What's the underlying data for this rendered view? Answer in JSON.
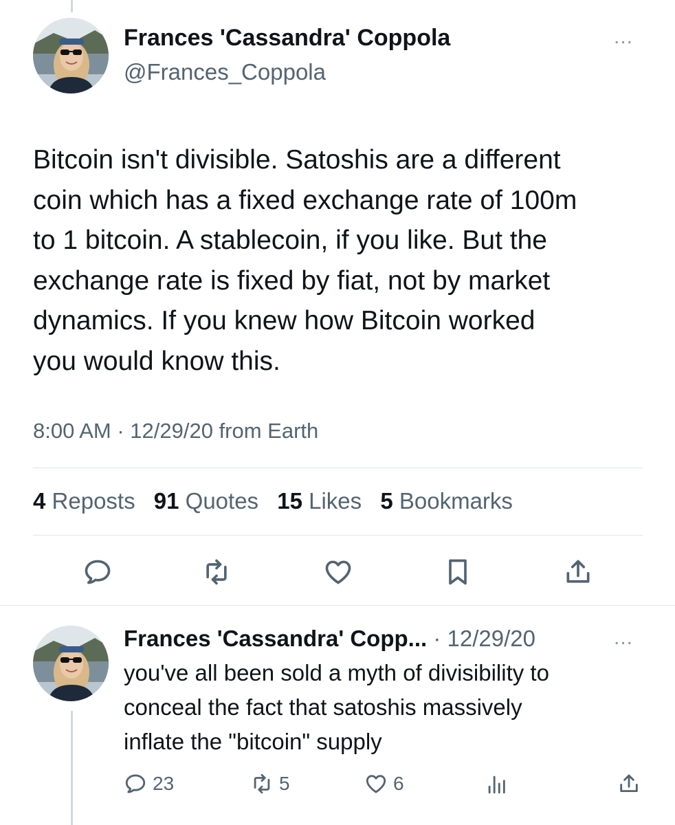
{
  "tweet": {
    "author_name": "Frances 'Cassandra' Coppola",
    "handle": "@Frances_Coppola",
    "more_icon": "...",
    "text": "Bitcoin isn't divisible. Satoshis are a different\ncoin which has a fixed exchange rate of 100m\nto 1 bitcoin. A stablecoin, if you like. But the\nexchange rate is fixed by fiat, not by market\ndynamics. If you knew how Bitcoin worked\nyou would know this.",
    "meta": "8:00 AM · 12/29/20 from Earth",
    "stats": [
      {
        "count": "4",
        "label": "Reposts"
      },
      {
        "count": "91",
        "label": "Quotes"
      },
      {
        "count": "15",
        "label": "Likes"
      },
      {
        "count": "5",
        "label": "Bookmarks"
      }
    ],
    "actions": [
      "reply-icon",
      "repost-icon",
      "like-icon",
      "bookmark-icon",
      "share-icon"
    ]
  },
  "reply": {
    "author_name": "Frances 'Cassandra' Copp...",
    "date": " · 12/29/20",
    "more_icon": "...",
    "text": "you've all been sold a myth of divisibility to\nconceal the fact that satoshis massively\ninflate the \"bitcoin\" supply",
    "actions": [
      {
        "icon": "reply-icon",
        "count": "23"
      },
      {
        "icon": "repost-icon",
        "count": "5"
      },
      {
        "icon": "like-icon",
        "count": "6"
      },
      {
        "icon": "views-icon",
        "count": ""
      },
      {
        "icon": "share-icon",
        "count": ""
      }
    ]
  },
  "colors": {
    "text": "#0f1419",
    "secondary": "#536471",
    "divider": "#e1e6ea",
    "thread_line": "#cfd9de"
  }
}
